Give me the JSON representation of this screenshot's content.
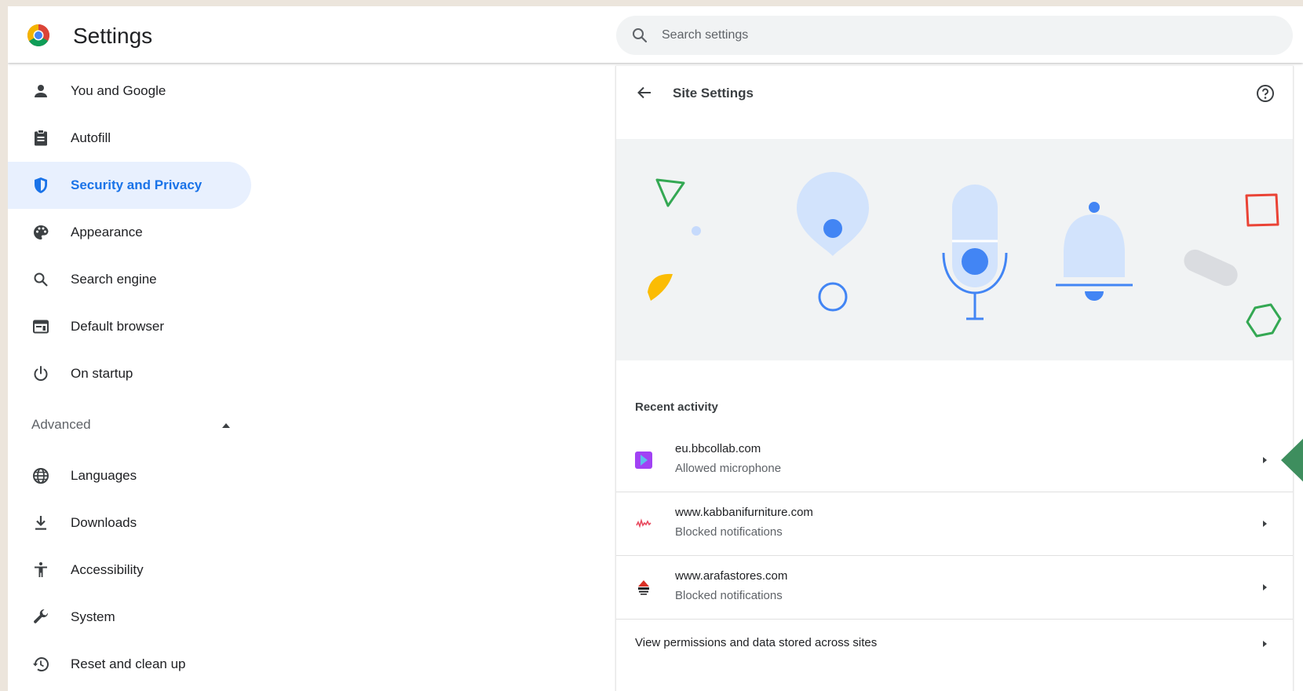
{
  "app": {
    "title": "Settings"
  },
  "search": {
    "placeholder": "Search settings",
    "value": ""
  },
  "sidebar": {
    "items": [
      {
        "label": "You and Google",
        "icon": "person-icon"
      },
      {
        "label": "Autofill",
        "icon": "clipboard-icon"
      },
      {
        "label": "Security and Privacy",
        "icon": "shield-icon",
        "active": true
      },
      {
        "label": "Appearance",
        "icon": "palette-icon"
      },
      {
        "label": "Search engine",
        "icon": "search-icon"
      },
      {
        "label": "Default browser",
        "icon": "browser-icon"
      },
      {
        "label": "On startup",
        "icon": "power-icon"
      }
    ],
    "advanced": {
      "label": "Advanced",
      "expanded": true,
      "items": [
        {
          "label": "Languages",
          "icon": "globe-icon"
        },
        {
          "label": "Downloads",
          "icon": "download-icon"
        },
        {
          "label": "Accessibility",
          "icon": "accessibility-icon"
        },
        {
          "label": "System",
          "icon": "wrench-icon"
        },
        {
          "label": "Reset and clean up",
          "icon": "restore-icon"
        }
      ]
    }
  },
  "panel": {
    "title": "Site Settings",
    "recent_activity": {
      "title": "Recent activity",
      "rows": [
        {
          "site": "eu.bbcollab.com",
          "status": "Allowed microphone",
          "favicon": "bbcollab-favicon"
        },
        {
          "site": "www.kabbanifurniture.com",
          "status": "Blocked notifications",
          "favicon": "kabbani-favicon"
        },
        {
          "site": "www.arafastores.com",
          "status": "Blocked notifications",
          "favicon": "arafa-favicon"
        }
      ]
    },
    "view_all_label": "View permissions and data stored across sites"
  },
  "colors": {
    "accent": "#1a73e8",
    "active_bg": "#e8f0fe",
    "hero_bg": "#f1f3f4",
    "pointer": "#3e8e5e"
  }
}
